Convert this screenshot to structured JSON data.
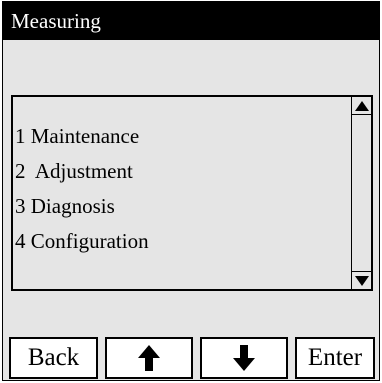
{
  "header": {
    "title": "Measuring"
  },
  "menu": {
    "items": [
      {
        "label": "1 Maintenance"
      },
      {
        "label": "2  Adjustment"
      },
      {
        "label": "3 Diagnosis"
      },
      {
        "label": "4 Configuration"
      }
    ],
    "scroll_up_icon": "triangle-up-icon",
    "scroll_down_icon": "triangle-down-icon"
  },
  "softkeys": {
    "back_label": "Back",
    "up_icon": "arrow-up-icon",
    "down_icon": "arrow-down-icon",
    "enter_label": "Enter"
  },
  "colors": {
    "title_bar": "#000000",
    "title_text": "#ffffff",
    "panel_background": "#e5e5e5",
    "button_background": "#ffffff"
  }
}
